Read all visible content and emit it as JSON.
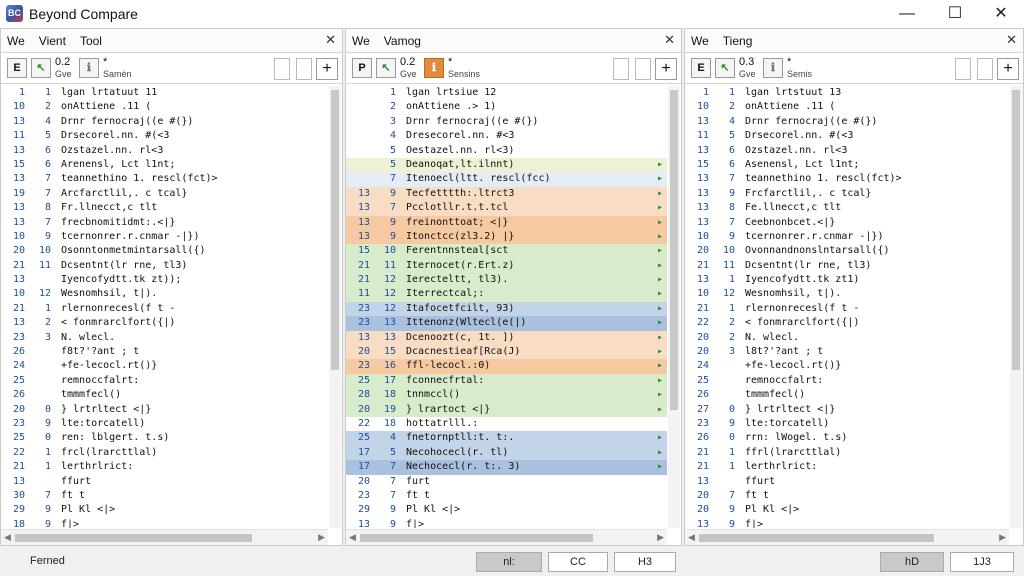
{
  "app": {
    "title": "Beyond Compare",
    "icon_name": "beyond-compare-logo-icon"
  },
  "window_controls": {
    "minimize": "—",
    "maximize": "☐",
    "close": "✕"
  },
  "panes": [
    {
      "id": "left",
      "tabs": [
        "We",
        "Vient",
        "Tool"
      ],
      "toolbar": {
        "num": "0.2",
        "num_label": "Gve",
        "star": "*",
        "star_label": "Samén"
      },
      "rows": [
        {
          "n1": "1",
          "n2": "1",
          "text": "lgan lrtatuut  11",
          "hl": ""
        },
        {
          "n1": "10",
          "n2": "2",
          "text": "  onAttiene .11  (",
          "hl": ""
        },
        {
          "n1": "13",
          "n2": "4",
          "text": "   Drnr fernocraj((e #(})",
          "hl": ""
        },
        {
          "n1": "11",
          "n2": "5",
          "text": "      Drsecorel.nn. #(<3",
          "hl": ""
        },
        {
          "n1": "13",
          "n2": "6",
          "text": "      Ozstazel.nn. rl<3",
          "hl": ""
        },
        {
          "n1": "15",
          "n2": "6",
          "text": "      Arenensl, Lct l1nt;",
          "hl": ""
        },
        {
          "n1": "13",
          "n2": "7",
          "text": "      teannethino  1. rescl(fct)>",
          "hl": ""
        },
        {
          "n1": "19",
          "n2": "7",
          "text": "      Arcfarctlil,. c tcal}",
          "hl": ""
        },
        {
          "n1": "13",
          "n2": "8",
          "text": "      Fr.llnecct,c tlt",
          "hl": ""
        },
        {
          "n1": "13",
          "n2": "7",
          "text": "      frecbnomitidmt:.<|}",
          "hl": ""
        },
        {
          "n1": "10",
          "n2": "9",
          "text": "      tcernonrer.r.cnmar -|})",
          "hl": ""
        },
        {
          "n1": "20",
          "n2": "10",
          "text": "      Osonntonmetmintarsall({)",
          "hl": ""
        },
        {
          "n1": "21",
          "n2": "11",
          "text": "      Dcsentnt(lr rne, tl3)",
          "hl": ""
        },
        {
          "n1": "13",
          "n2": "",
          "text": "      Iyencofydtt.tk  zt));",
          "hl": ""
        },
        {
          "n1": "10",
          "n2": "12",
          "text": "      Wesnomhsil, t|).",
          "hl": ""
        },
        {
          "n1": "21",
          "n2": "1",
          "text": "    rlernonrecesl(f  t  -",
          "hl": ""
        },
        {
          "n1": "13",
          "n2": "2",
          "text": "      < fonmrarclfort({|)",
          "hl": ""
        },
        {
          "n1": "23",
          "n2": "3",
          "text": "         N. wlecl.",
          "hl": ""
        },
        {
          "n1": "26",
          "n2": "",
          "text": "     f8t?'?ant  ;   t",
          "hl": ""
        },
        {
          "n1": "24",
          "n2": "",
          "text": "     +fe-lecocl.rt()}",
          "hl": ""
        },
        {
          "n1": "25",
          "n2": "",
          "text": "       remnoccfalrt:",
          "hl": ""
        },
        {
          "n1": "26",
          "n2": "",
          "text": "       tmmmfecl()",
          "hl": ""
        },
        {
          "n1": "20",
          "n2": "0",
          "text": "     }  lrtrltect  <|}",
          "hl": ""
        },
        {
          "n1": "23",
          "n2": "9",
          "text": "      lte:torcatell)",
          "hl": ""
        },
        {
          "n1": "25",
          "n2": "0",
          "text": "     ren: lblgert. t.s)",
          "hl": ""
        },
        {
          "n1": "22",
          "n2": "1",
          "text": "     frcl(lrarcttlal)",
          "hl": ""
        },
        {
          "n1": "21",
          "n2": "1",
          "text": "      lerthrlrict:",
          "hl": ""
        },
        {
          "n1": "13",
          "n2": "",
          "text": "     ffurt",
          "hl": ""
        },
        {
          "n1": "30",
          "n2": "7",
          "text": "    ft    t",
          "hl": ""
        },
        {
          "n1": "29",
          "n2": "9",
          "text": "    Pl   Kl  <|>",
          "hl": ""
        },
        {
          "n1": "18",
          "n2": "9",
          "text": "       f|>",
          "hl": ""
        }
      ]
    },
    {
      "id": "middle",
      "tabs": [
        "We",
        "Vamog"
      ],
      "toolbar": {
        "num": "0.2",
        "num_label": "Gve",
        "star": "*",
        "star_label": "Sensins"
      },
      "rows": [
        {
          "n1": "",
          "n2": "1",
          "text": "lgan lrtsiue  12",
          "hl": ""
        },
        {
          "n1": "",
          "n2": "2",
          "text": "  onAttiene .>  1)",
          "hl": ""
        },
        {
          "n1": "",
          "n2": "3",
          "text": "   Drnr fernocraj((e #(})",
          "hl": ""
        },
        {
          "n1": "",
          "n2": "4",
          "text": "      Dresecorel.nn. #<3",
          "hl": ""
        },
        {
          "n1": "",
          "n2": "5",
          "text": "      Oestazel.nn. rl<3)",
          "hl": ""
        },
        {
          "n1": "",
          "n2": "5",
          "text": "      Deanoqat,lt.ilnnt)",
          "hl": "hl-yellow"
        },
        {
          "n1": "",
          "n2": "7",
          "text": "      Itenoecl(ltt.  rescl(fcc)",
          "hl": "hl-lblue"
        },
        {
          "n1": "13",
          "n2": "9",
          "text": "      Tecfetttth:.ltrct3",
          "hl": "hl-peach"
        },
        {
          "n1": "13",
          "n2": "7",
          "text": "      Pcclotllr.t.t.tcl",
          "hl": "hl-peach"
        },
        {
          "n1": "13",
          "n2": "9",
          "text": "      freinonttoat;   <|}",
          "hl": "hl-orange"
        },
        {
          "n1": "13",
          "n2": "9",
          "text": "      Itonctcc(zl3.2)  |}",
          "hl": "hl-orange"
        },
        {
          "n1": "15",
          "n2": "10",
          "text": "      Ferentnnsteal[sct",
          "hl": "hl-green"
        },
        {
          "n1": "21",
          "n2": "11",
          "text": "      Iternocet(r.Ert.z)",
          "hl": "hl-green"
        },
        {
          "n1": "21",
          "n2": "12",
          "text": "      Ierecteltt,  tl3).",
          "hl": "hl-green"
        },
        {
          "n1": "11",
          "n2": "12",
          "text": "      Iterrectcal;:",
          "hl": "hl-green"
        },
        {
          "n1": "23",
          "n2": "12",
          "text": "      Itafocetfcilt, 93)",
          "hl": "hl-blue"
        },
        {
          "n1": "23",
          "n2": "13",
          "text": "      Ittenonz(Wltecl(e(|)",
          "hl": "hl-blue2"
        },
        {
          "n1": "13",
          "n2": "13",
          "text": "      Dcenoozt(c,  1t.  ])",
          "hl": "hl-peach"
        },
        {
          "n1": "20",
          "n2": "15",
          "text": "      Dcacnestieaf[Rca(J)",
          "hl": "hl-peach"
        },
        {
          "n1": "23",
          "n2": "16",
          "text": "      ffl-lecocl.:0)",
          "hl": "hl-orange"
        },
        {
          "n1": "25",
          "n2": "17",
          "text": "       fconnecfrtal:",
          "hl": "hl-green"
        },
        {
          "n1": "28",
          "n2": "18",
          "text": "       tnnmccl()",
          "hl": "hl-green"
        },
        {
          "n1": "20",
          "n2": "19",
          "text": "     }  lrartoct  <|}",
          "hl": "hl-green"
        },
        {
          "n1": "22",
          "n2": "18",
          "text": "      hottatrlll.:",
          "hl": ""
        },
        {
          "n1": "25",
          "n2": "4",
          "text": "     fnetornptll:t.  t:.",
          "hl": "hl-blue"
        },
        {
          "n1": "17",
          "n2": "5",
          "text": "     Necohocecl(r.  tl)",
          "hl": "hl-blue"
        },
        {
          "n1": "17",
          "n2": "7",
          "text": "     Nechocecl(r.  t:.  3)",
          "hl": "hl-blue2"
        },
        {
          "n1": "20",
          "n2": "7",
          "text": "     furt",
          "hl": ""
        },
        {
          "n1": "23",
          "n2": "7",
          "text": "    ft    t",
          "hl": ""
        },
        {
          "n1": "29",
          "n2": "9",
          "text": "    Pl   Kl  <|>",
          "hl": ""
        },
        {
          "n1": "13",
          "n2": "9",
          "text": "       f|>",
          "hl": ""
        }
      ]
    },
    {
      "id": "right",
      "tabs": [
        "We",
        "Tieng"
      ],
      "toolbar": {
        "num": "0.3",
        "num_label": "Gve",
        "star": "*",
        "star_label": "Semis"
      },
      "rows": [
        {
          "n1": "1",
          "n2": "1",
          "text": "lgan lrtstuut  13",
          "hl": ""
        },
        {
          "n1": "10",
          "n2": "2",
          "text": "  onAttiene .11  (",
          "hl": ""
        },
        {
          "n1": "13",
          "n2": "4",
          "text": "   Drnr fernocraj((e #(})",
          "hl": ""
        },
        {
          "n1": "11",
          "n2": "5",
          "text": "      Drsecorel.nn. #(<3",
          "hl": ""
        },
        {
          "n1": "13",
          "n2": "6",
          "text": "      Ozstazel.nn. rl<3",
          "hl": ""
        },
        {
          "n1": "15",
          "n2": "6",
          "text": "      Asenensl, Lct l1nt;",
          "hl": ""
        },
        {
          "n1": "13",
          "n2": "7",
          "text": "      teannethino  1. rescl(fct)>",
          "hl": ""
        },
        {
          "n1": "13",
          "n2": "9",
          "text": "      Frcfarctlil,. c tcal}",
          "hl": ""
        },
        {
          "n1": "13",
          "n2": "8",
          "text": "      Fe.llnecct,c tlt",
          "hl": ""
        },
        {
          "n1": "13",
          "n2": "7",
          "text": "      Ceebnonbcet.<|}",
          "hl": ""
        },
        {
          "n1": "10",
          "n2": "9",
          "text": "      tcernonrer.r.cnmar -|})",
          "hl": ""
        },
        {
          "n1": "20",
          "n2": "10",
          "text": "      Ovonnandnonslntarsall({)",
          "hl": ""
        },
        {
          "n1": "21",
          "n2": "11",
          "text": "      Dcsentnt(lr rne, tl3)",
          "hl": ""
        },
        {
          "n1": "13",
          "n2": "1",
          "text": "      Iyencofydtt.tk  zt1)",
          "hl": ""
        },
        {
          "n1": "10",
          "n2": "12",
          "text": "      Wesnomhsil, t|).",
          "hl": ""
        },
        {
          "n1": "21",
          "n2": "1",
          "text": "    rlernonrecesl(f  t  -",
          "hl": ""
        },
        {
          "n1": "22",
          "n2": "2",
          "text": "      < fonmrarclfort({|)",
          "hl": ""
        },
        {
          "n1": "20",
          "n2": "2",
          "text": "         N. wlecl.",
          "hl": ""
        },
        {
          "n1": "20",
          "n2": "3",
          "text": "     l8t?'?ant  ;   t",
          "hl": ""
        },
        {
          "n1": "24",
          "n2": "",
          "text": "     +fe-lecocl.rt()}",
          "hl": ""
        },
        {
          "n1": "25",
          "n2": "",
          "text": "       remnoccfalrt:",
          "hl": ""
        },
        {
          "n1": "26",
          "n2": "",
          "text": "       tmmmfecl()",
          "hl": ""
        },
        {
          "n1": "27",
          "n2": "0",
          "text": "     }  lrtrltect  <|}",
          "hl": ""
        },
        {
          "n1": "23",
          "n2": "9",
          "text": "      lte:torcatell)",
          "hl": ""
        },
        {
          "n1": "26",
          "n2": "0",
          "text": "     rrn: lWogel. t.s)",
          "hl": ""
        },
        {
          "n1": "21",
          "n2": "1",
          "text": "     ffrl(lrarcttlal)",
          "hl": ""
        },
        {
          "n1": "21",
          "n2": "1",
          "text": "      lerthrlrict:",
          "hl": ""
        },
        {
          "n1": "13",
          "n2": "",
          "text": "     ffurt",
          "hl": ""
        },
        {
          "n1": "20",
          "n2": "7",
          "text": "    ft    t",
          "hl": ""
        },
        {
          "n1": "20",
          "n2": "9",
          "text": "    Pl   Kl  <|>",
          "hl": ""
        },
        {
          "n1": "13",
          "n2": "9",
          "text": "       f|>",
          "hl": ""
        }
      ]
    }
  ],
  "statusbar": {
    "left_label": "Ferned",
    "cells": [
      "nl:",
      "CC",
      "H3",
      "hD",
      "1J3"
    ]
  }
}
